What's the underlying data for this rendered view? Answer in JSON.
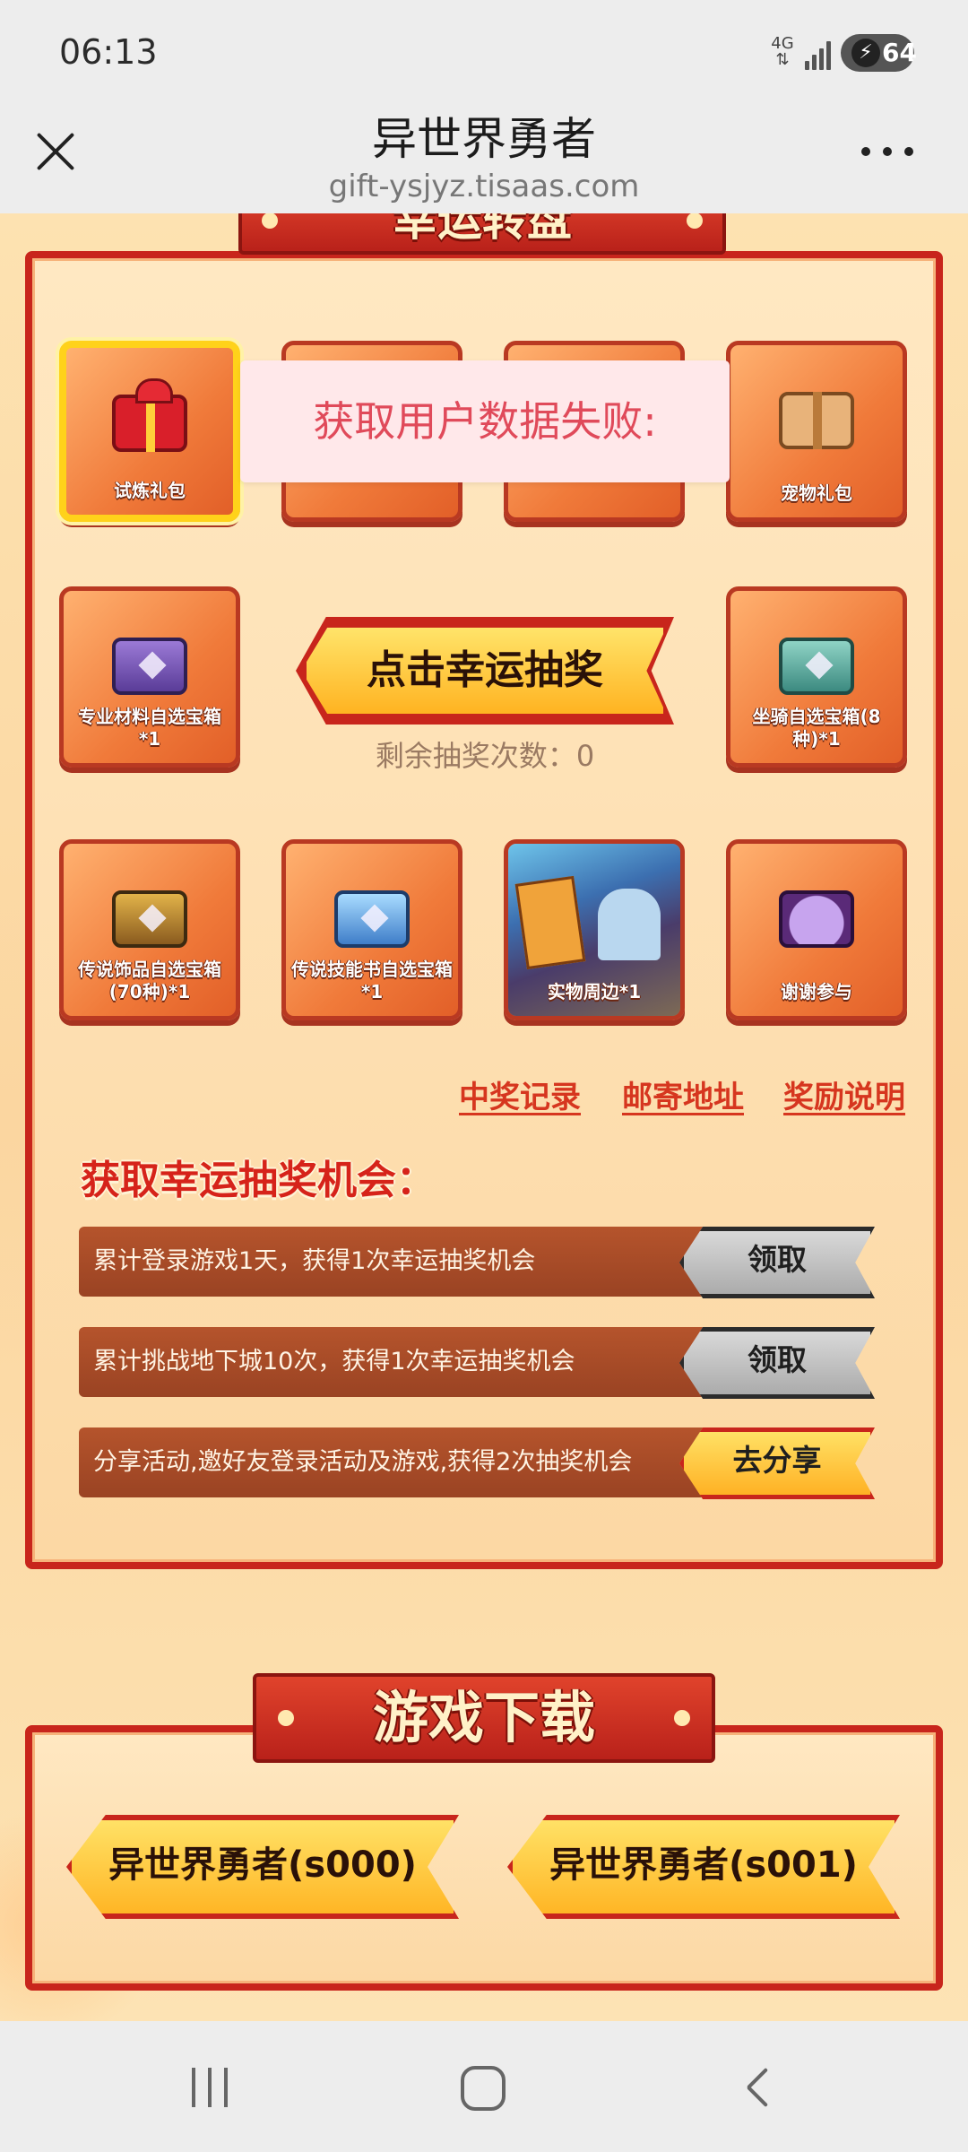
{
  "status_bar": {
    "time": "06:13",
    "network": "4G",
    "battery": "64",
    "icons": [
      "signal-icon",
      "charging-icon"
    ]
  },
  "header": {
    "title": "异世界勇者",
    "url": "gift-ysjyz.tisaas.com",
    "close_icon": "close-icon",
    "more_icon": "more-icon"
  },
  "lottery": {
    "title": "幸运转盘",
    "prizes": [
      {
        "label": "试炼礼包",
        "icon": "red-gift-icon",
        "selected": true
      },
      {
        "label": "",
        "icon": ""
      },
      {
        "label": "",
        "icon": ""
      },
      {
        "label": "宠物礼包",
        "icon": "pet-gift-icon"
      },
      {
        "label": "专业材料自选宝箱*1",
        "icon": "purple-chest-icon"
      },
      {
        "label": "坐骑自选宝箱(8种)*1",
        "icon": "teal-chest-icon"
      },
      {
        "label": "传说饰品自选宝箱(70种)*1",
        "icon": "gold-chest-icon"
      },
      {
        "label": "传说技能书自选宝箱*1",
        "icon": "blue-chest-icon"
      },
      {
        "label": "实物周边*1",
        "icon": "merchandise-photo"
      },
      {
        "label": "谢谢参与",
        "icon": "thanks-character-icon"
      }
    ],
    "draw_button": "点击幸运抽奖",
    "remaining_label": "剩余抽奖次数：",
    "remaining_count": "0",
    "error_toast": "获取用户数据失败:",
    "links": {
      "records": "中奖记录",
      "address": "邮寄地址",
      "rules": "奖励说明"
    }
  },
  "chances": {
    "title": "获取幸运抽奖机会：",
    "tasks": [
      {
        "text": "累计登录游戏1天，获得1次幸运抽奖机会",
        "button": "领取",
        "state": "disabled"
      },
      {
        "text": "累计挑战地下城10次，获得1次幸运抽奖机会",
        "button": "领取",
        "state": "disabled"
      },
      {
        "text": "分享活动,邀好友登录活动及游戏,获得2次抽奖机会",
        "button": "去分享",
        "state": "active"
      }
    ]
  },
  "download": {
    "title": "游戏下载",
    "buttons": [
      "异世界勇者(s000)",
      "异世界勇者(s001)"
    ]
  },
  "colors": {
    "accent_red": "#c8251c",
    "gold": "#ffd21a",
    "error_text": "#e04a5a"
  }
}
